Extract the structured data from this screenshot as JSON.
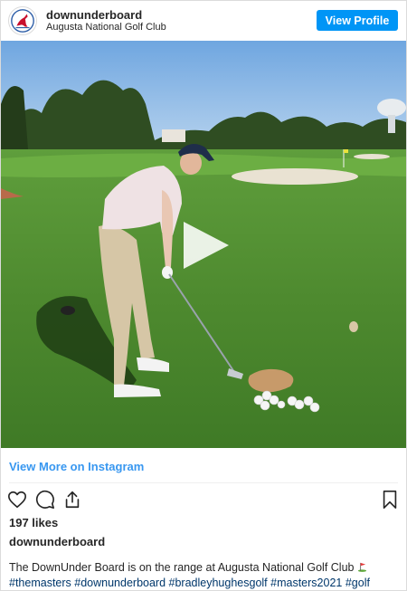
{
  "header": {
    "username": "downunderboard",
    "location": "Augusta National Golf Club",
    "view_profile_label": "View Profile"
  },
  "media": {
    "type": "video",
    "play_icon": "play-icon"
  },
  "view_more_label": "View More on Instagram",
  "actions": {
    "like_icon": "heart-outline-icon",
    "comment_icon": "comment-icon",
    "share_icon": "share-icon",
    "save_icon": "bookmark-icon"
  },
  "likes_text": "197 likes",
  "owner_username": "downunderboard",
  "caption": {
    "text": "The DownUnder Board is on the range at Augusta National Golf Club",
    "emoji_icon": "golf-flag-icon",
    "hashtags": [
      "#themasters",
      "#downunderboard",
      "#bradleyhughesgolf",
      "#masters2021",
      "#golf"
    ]
  },
  "colors": {
    "button_blue": "#0095f6",
    "link_blue": "#3897f0",
    "hashtag_blue": "#00376b",
    "text": "#262626"
  }
}
